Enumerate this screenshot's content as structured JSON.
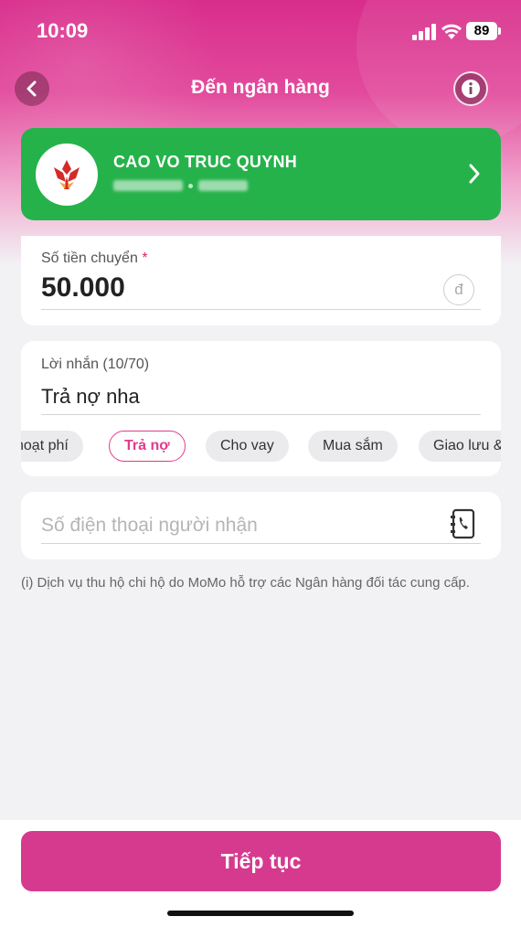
{
  "status_bar": {
    "time": "10:09",
    "battery": "89"
  },
  "header": {
    "title": "Đến ngân hàng",
    "back_icon": "chevron-left-icon",
    "info_icon": "info-icon"
  },
  "recipient": {
    "name": "CAO VO TRUC QUYNH",
    "account_masked": "",
    "bank_logo_icon": "bank-logo",
    "color": "#26b24b"
  },
  "amount": {
    "label": "Số tiền chuyển",
    "required_mark": "*",
    "value": "50.000",
    "currency_symbol": "đ"
  },
  "message": {
    "label": "Lời nhắn (10/70)",
    "value": "Trả nợ nha",
    "chips": [
      "hoạt phí",
      "Trả nợ",
      "Cho vay",
      "Mua sắm",
      "Giao lưu &"
    ],
    "selected_chip": "Trả nợ"
  },
  "phone": {
    "placeholder": "Số điện thoại người nhận",
    "contact_icon": "contact-book-icon"
  },
  "note": "(i) Dịch vụ thu hộ chi hộ do MoMo hỗ trợ các Ngân hàng đối tác cung cấp.",
  "footer": {
    "continue_label": "Tiếp tục",
    "accent": "#d63a8f"
  }
}
